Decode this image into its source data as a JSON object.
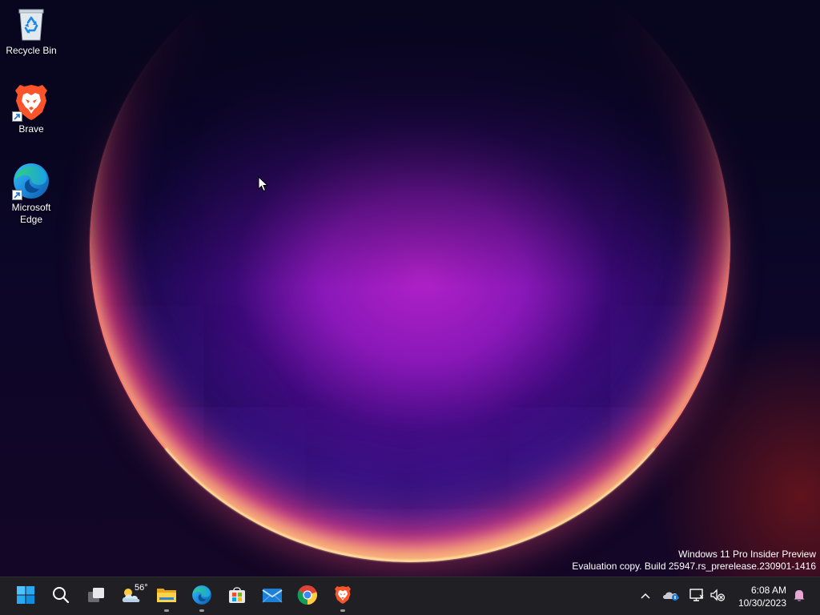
{
  "desktop": {
    "icons": [
      {
        "label": "Recycle Bin",
        "icon": "recycle-bin-icon"
      },
      {
        "label": "Brave",
        "icon": "brave-icon",
        "shortcut": true
      },
      {
        "label": "Microsoft\nEdge",
        "icon": "edge-icon",
        "shortcut": true
      }
    ]
  },
  "watermark": {
    "line1": "Windows 11 Pro Insider Preview",
    "line2": "Evaluation copy. Build 25947.rs_prerelease.230901-1416"
  },
  "taskbar": {
    "buttons": [
      {
        "name": "start",
        "icon": "windows-logo-icon"
      },
      {
        "name": "search",
        "icon": "search-icon"
      },
      {
        "name": "task-view",
        "icon": "task-view-icon"
      },
      {
        "name": "widgets",
        "icon": "weather-icon",
        "temp": "56°"
      },
      {
        "name": "file-explorer",
        "icon": "folder-icon",
        "running": true
      },
      {
        "name": "edge",
        "icon": "edge-icon",
        "running": true
      },
      {
        "name": "store",
        "icon": "store-icon"
      },
      {
        "name": "mail",
        "icon": "mail-icon"
      },
      {
        "name": "chrome",
        "icon": "chrome-icon"
      },
      {
        "name": "brave",
        "icon": "brave-icon",
        "running": true
      }
    ],
    "tray": {
      "icons": [
        "chevron-up-icon",
        "onedrive-icon",
        "network-icon",
        "volume-muted-icon"
      ],
      "time": "6:08 AM",
      "date": "10/30/2023",
      "notification_icon": "bell-icon"
    }
  },
  "colors": {
    "taskbar_bg": "#1f1f24",
    "accent": "#0078d4",
    "brave": "#fb542b",
    "notification": "#e9a7d6"
  }
}
